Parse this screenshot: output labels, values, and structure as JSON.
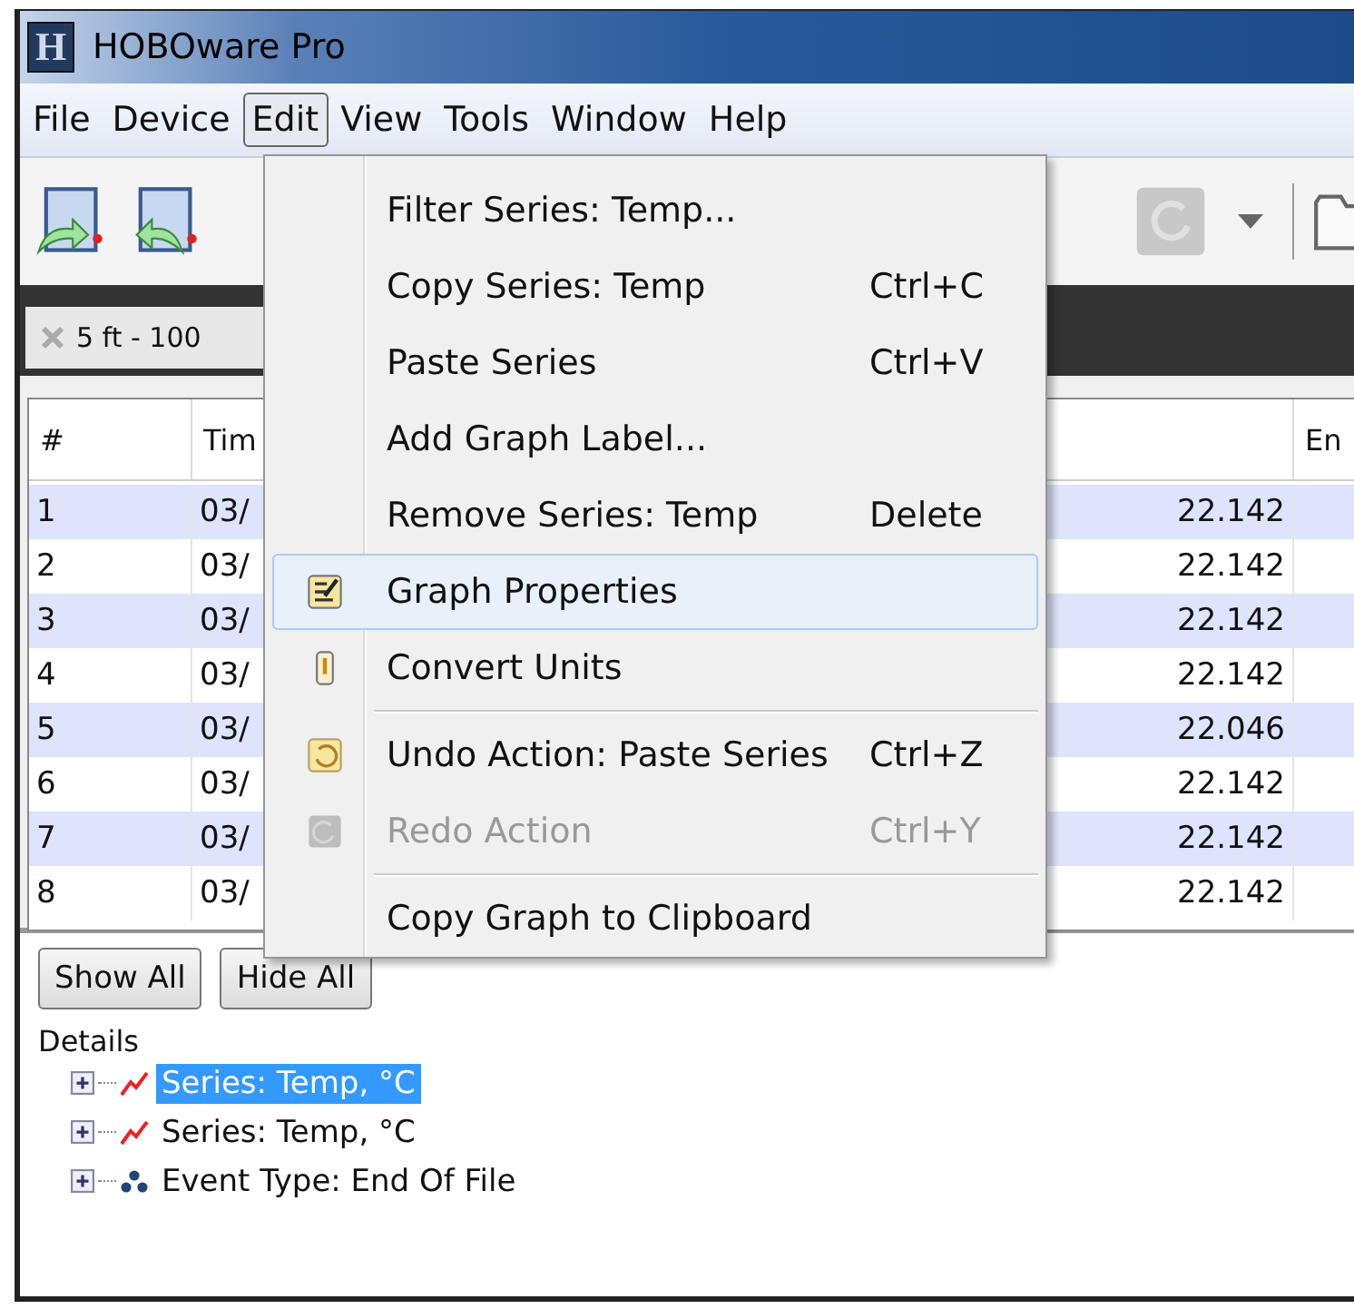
{
  "window": {
    "logo": "H",
    "title": "HOBOware Pro"
  },
  "menu_bar": [
    {
      "label": "File",
      "selected": false
    },
    {
      "label": "Device",
      "selected": false
    },
    {
      "label": "Edit",
      "selected": true
    },
    {
      "label": "View",
      "selected": false
    },
    {
      "label": "Tools",
      "selected": false
    },
    {
      "label": "Window",
      "selected": false
    },
    {
      "label": "Help",
      "selected": false
    }
  ],
  "tab": {
    "label": "5 ft - 100"
  },
  "table": {
    "columns": [
      "#",
      "Tim",
      "",
      "En"
    ],
    "rows": [
      {
        "cells": [
          "1",
          "03/",
          "22.142"
        ]
      },
      {
        "cells": [
          "2",
          "03/",
          "22.142"
        ]
      },
      {
        "cells": [
          "3",
          "03/",
          "22.142"
        ]
      },
      {
        "cells": [
          "4",
          "03/",
          "22.142"
        ]
      },
      {
        "cells": [
          "5",
          "03/",
          "22.046"
        ]
      },
      {
        "cells": [
          "6",
          "03/",
          "22.142"
        ]
      },
      {
        "cells": [
          "7",
          "03/",
          "22.142"
        ]
      },
      {
        "cells": [
          "8",
          "03/",
          "22.142"
        ]
      }
    ]
  },
  "buttons": [
    "Show All",
    "Hide All"
  ],
  "details": {
    "label": "Details",
    "items": [
      {
        "kind": "series",
        "label": "Series: Temp, °C",
        "selected": true
      },
      {
        "kind": "series",
        "label": "Series: Temp, °C",
        "selected": false
      },
      {
        "kind": "event",
        "label": "Event Type: End Of File",
        "selected": false
      }
    ]
  },
  "edit_menu": [
    {
      "kind": "item",
      "label": "Filter Series: Temp...",
      "disabled": false,
      "selected": false
    },
    {
      "kind": "item",
      "label": "Copy Series: Temp",
      "shortcut": "Ctrl+C",
      "disabled": false,
      "selected": false
    },
    {
      "kind": "item",
      "label": "Paste Series",
      "shortcut": "Ctrl+V",
      "disabled": false,
      "selected": false
    },
    {
      "kind": "item",
      "label": "Add Graph Label...",
      "disabled": false,
      "selected": false
    },
    {
      "kind": "item",
      "label": "Remove Series: Temp",
      "shortcut": "Delete",
      "disabled": false,
      "selected": false
    },
    {
      "kind": "properties",
      "label": "Graph Properties",
      "disabled": false,
      "selected": true
    },
    {
      "kind": "units",
      "label": "Convert Units",
      "disabled": false,
      "selected": false
    },
    {
      "kind": "separator"
    },
    {
      "kind": "undo",
      "label": "Undo Action: Paste Series",
      "shortcut": "Ctrl+Z",
      "disabled": false,
      "selected": false
    },
    {
      "kind": "redo",
      "label": "Redo Action",
      "shortcut": "Ctrl+Y",
      "disabled": true,
      "selected": false
    },
    {
      "kind": "separator"
    },
    {
      "kind": "item",
      "label": "Copy Graph to Clipboard",
      "disabled": false,
      "selected": false
    }
  ]
}
